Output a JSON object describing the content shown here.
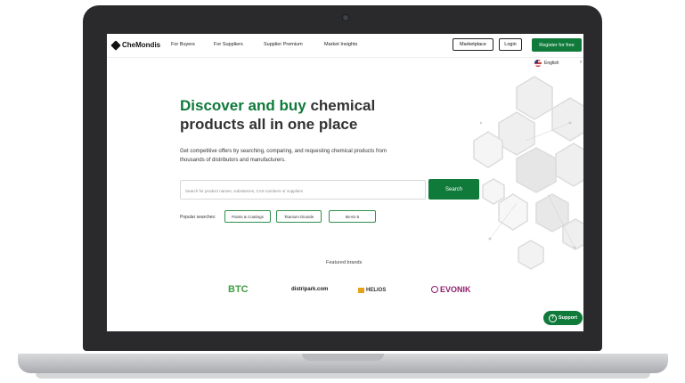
{
  "nav": {
    "logo": "CheMondis",
    "links": [
      "For Buyers",
      "For Suppliers",
      "Supplier Premium",
      "Market Insights"
    ],
    "marketplace": "Marketplace",
    "login": "Login",
    "register": "Register for free",
    "language": "English"
  },
  "hero": {
    "headline_accent": "Discover and buy",
    "headline_rest": "chemical products all in one place",
    "subtitle": "Get competitive offers by searching, comparing, and requesting chemical products from thousands of distributors and manufacturers."
  },
  "search": {
    "placeholder": "Search for product names, substances, CAS numbers or suppliers",
    "button": "Search"
  },
  "popular": {
    "label": "Popular searches:",
    "items": [
      "Paints & Coatings",
      "Titanium Dioxide",
      "56-81-5"
    ]
  },
  "featured": {
    "title": "Featured brands",
    "brands": [
      "BTC",
      "distripark.com",
      "HELIOS",
      "EVONIK"
    ]
  },
  "support": "Support",
  "colors": {
    "brand_green": "#0f7a3a"
  }
}
